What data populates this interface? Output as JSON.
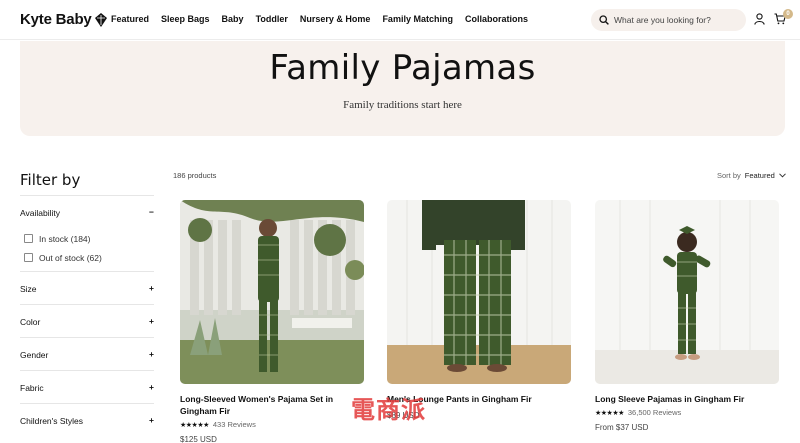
{
  "brand": {
    "name": "Kyte Baby"
  },
  "nav": [
    "Featured",
    "Sleep Bags",
    "Baby",
    "Toddler",
    "Nursery & Home",
    "Family Matching",
    "Collaborations"
  ],
  "search": {
    "placeholder": "What are you looking for?"
  },
  "cart": {
    "count": "0"
  },
  "hero": {
    "title": "Family Pajamas",
    "subtitle": "Family traditions start here"
  },
  "filters": {
    "title": "Filter by",
    "availability": {
      "label": "Availability",
      "toggle": "−",
      "options": [
        "In stock (184)",
        "Out of stock (62)"
      ]
    },
    "groups": [
      {
        "label": "Size",
        "toggle": "+"
      },
      {
        "label": "Color",
        "toggle": "+"
      },
      {
        "label": "Gender",
        "toggle": "+"
      },
      {
        "label": "Fabric",
        "toggle": "+"
      },
      {
        "label": "Children's Styles",
        "toggle": "+"
      }
    ]
  },
  "results": {
    "count": "186 products",
    "sort_label": "Sort by",
    "sort_value": "Featured"
  },
  "products": [
    {
      "name": "Long-Sleeved Women's Pajama Set in Gingham Fir",
      "stars": "★★★★★",
      "reviews": "433 Reviews",
      "price": "$125 USD"
    },
    {
      "name": "Men's Lounge Pants in Gingham Fir",
      "stars": "",
      "reviews": "",
      "price": "$89 USD"
    },
    {
      "name": "Long Sleeve Pajamas in Gingham Fir",
      "stars": "★★★★★",
      "reviews": "36,500 Reviews",
      "price": "From $37 USD"
    }
  ],
  "colors": {
    "hero_bg": "#f7f1ed",
    "gingham": "#3f5a2c",
    "cart_badge": "#d4b98a"
  },
  "watermark": "電商派"
}
